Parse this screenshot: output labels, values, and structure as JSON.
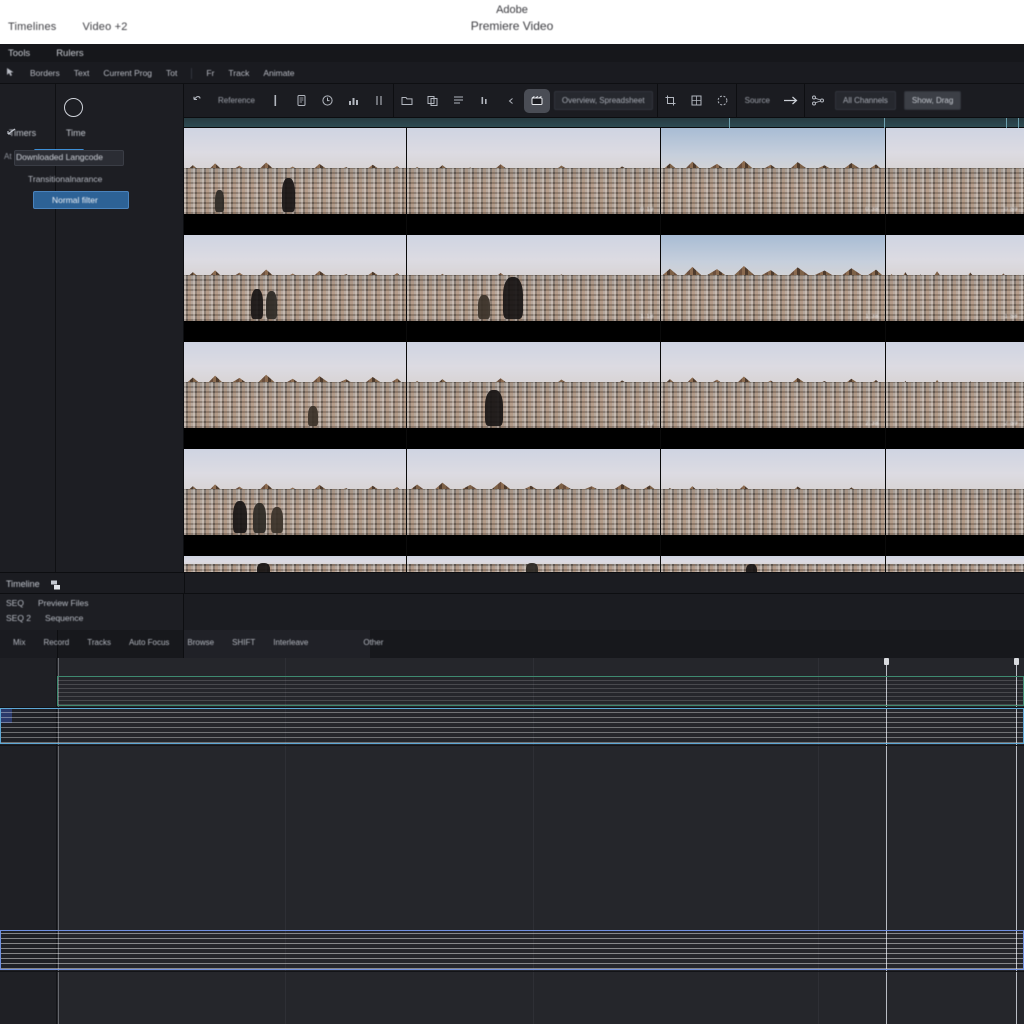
{
  "app": {
    "title_line1": "Adobe",
    "title_line2": "Premiere Video",
    "menu_items": [
      "Timelines",
      "Video +2"
    ]
  },
  "toolbar_tabs": {
    "items": [
      "Tools",
      "Rulers"
    ]
  },
  "toolbar_secondary": {
    "items": [
      "Borders",
      "Text",
      "Current Prog",
      "Tot",
      "Fr",
      "Track",
      "Animate"
    ],
    "icon": "cursor-icon"
  },
  "left_panel": {
    "circle_icon": "circle-icon",
    "back_icon": "back-arrow-icon",
    "tabs": [
      {
        "label": "Timers",
        "selected": false
      },
      {
        "label": "Time",
        "selected": true
      }
    ],
    "field_prefix": "At",
    "field_value": "Downloaded Langcode",
    "subtitle": "Transitionalnarance",
    "selected_item": "Normal filter"
  },
  "main_toolbar": {
    "group1": {
      "undo_icon": "undo-icon",
      "undo_label": "Reference",
      "icons": [
        "text-cursor-icon",
        "document-icon",
        "clock-icon",
        "chart-icon",
        "align-icon"
      ]
    },
    "group2": {
      "icons": [
        "folder-icon",
        "copy-icon",
        "list-icon",
        "bars-icon",
        "chevron-left-icon"
      ],
      "active_icon": "clapperboard-icon",
      "chip_label": "Overview, Spreadsheet"
    },
    "group3": {
      "icons": [
        "crop-icon",
        "grid-icon",
        "selection-icon"
      ]
    },
    "group4": {
      "label": "Source",
      "arrow_icon": "arrow-right-icon"
    },
    "group5": {
      "icon": "node-graph-icon",
      "chip_label": "All Channels",
      "chip_light_label": "Show, Drag"
    }
  },
  "grid": {
    "timestamps": [
      "0:19",
      "0:38",
      "0:59",
      "1:18",
      "1:38",
      "1:58",
      "2:19",
      "2:38",
      "2:59"
    ],
    "columns": 4,
    "rows": 5
  },
  "timeline": {
    "panel_title": "Timeline",
    "panel_icon": "sequence-icon",
    "meta_row1": [
      "SEQ",
      "Preview Files"
    ],
    "meta_row2": [
      "SEQ 2",
      "Sequence"
    ],
    "tool_labels": [
      "Mix",
      "Record",
      "Tracks",
      "Auto Focus",
      "Browse",
      "SHIFT",
      "Interleave",
      "Other"
    ],
    "tracks": [
      {
        "name": "video-track-1",
        "color": "#63b296",
        "kind": "green"
      },
      {
        "name": "video-track-2",
        "color": "#8fd0f4",
        "kind": "cyan"
      },
      {
        "name": "audio-track-1",
        "color": "#9db6f4",
        "kind": "blue"
      }
    ]
  },
  "colors": {
    "header_bg": "#ffffff",
    "panel_bg": "#1d1e23",
    "timeline_bg": "#25262b",
    "accent_blue": "#3d8fd6",
    "selection_blue": "#2d6296",
    "clip_green": "#63b296",
    "clip_cyan": "#8fd0f4",
    "clip_blue": "#9db6f4"
  }
}
